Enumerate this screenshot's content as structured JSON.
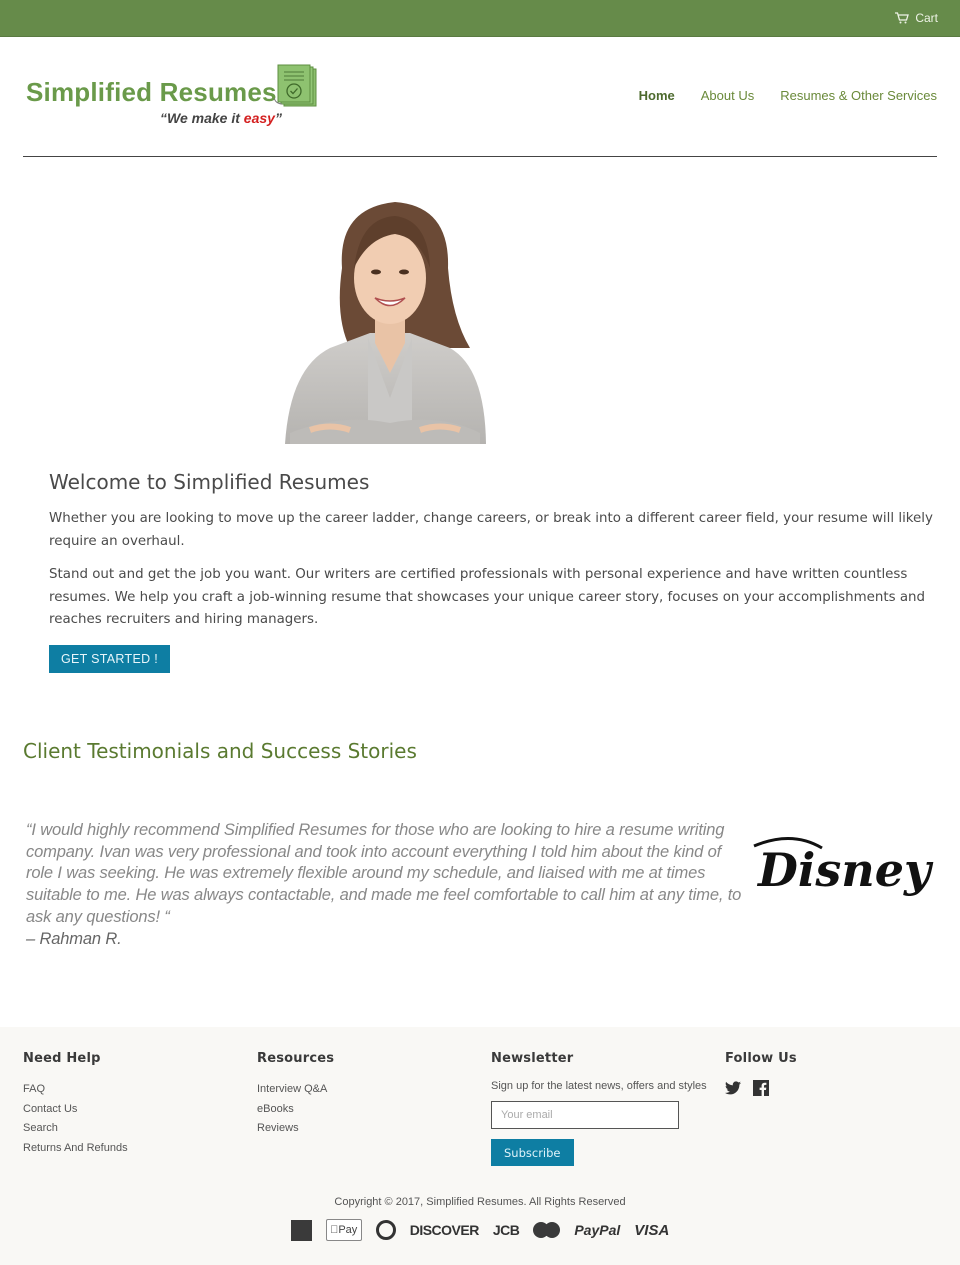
{
  "topbar": {
    "cart_label": "Cart",
    "bg_color": "#668b4a"
  },
  "logo": {
    "name": "Simplified Resumes",
    "tagline_prefix": "“We make it ",
    "tagline_emphasis": "easy",
    "tagline_suffix": "”"
  },
  "nav": {
    "items": [
      {
        "label": "Home",
        "active": true
      },
      {
        "label": "About Us",
        "active": false
      },
      {
        "label": "Resumes & Other Services",
        "active": false
      }
    ]
  },
  "hero": {
    "image_alt": "smiling professional woman with crossed arms"
  },
  "welcome": {
    "title": "Welcome to Simplified Resumes",
    "paragraph1": "Whether you are looking to move up the career ladder, change careers, or break into a different career field, your resume will likely require an overhaul.",
    "paragraph2": "Stand out and get the job you want. Our writers are certified professionals with personal experience and have written countless resumes. We help you craft a job-winning resume that showcases your unique career story, focuses on your accomplishments and reaches recruiters and hiring managers.",
    "cta_label": "GET STARTED !",
    "cta_color": "#0e7ea3"
  },
  "testimonials": {
    "title": "Client Testimonials and Success Stories",
    "quote": "“I would highly recommend Simplified Resumes for those who are looking to hire a resume writing company.  Ivan was very professional and took into account everything I told him about the kind of role I was seeking. He was extremely flexible around my schedule, and liaised with me at times suitable to me. He was always contactable, and made me feel comfortable to call him at any time, to ask any questions! “",
    "author": "– Rahman R.",
    "company_logo": "Disney"
  },
  "footer": {
    "need_help": {
      "title": "Need Help",
      "links": [
        "FAQ",
        "Contact Us",
        "Search",
        "Returns And Refunds"
      ]
    },
    "resources": {
      "title": "Resources",
      "links": [
        "Interview Q&A",
        "eBooks",
        "Reviews"
      ]
    },
    "newsletter": {
      "title": "Newsletter",
      "text": "Sign up for the latest news, offers and styles",
      "email_placeholder": "Your email",
      "email_value": "",
      "subscribe_label": "Subscribe"
    },
    "follow": {
      "title": "Follow Us",
      "icons": [
        "twitter-icon",
        "facebook-icon"
      ]
    },
    "copyright": "Copyright © 2017, Simplified Resumes. All Rights Reserved",
    "payments": {
      "american_express": "American Express",
      "apple_pay": "Pay",
      "diners_club": "Diners Club",
      "discover": "DISCOVER",
      "jcb": "JCB",
      "master": "Master",
      "paypal": "PayPal",
      "visa": "VISA"
    }
  }
}
